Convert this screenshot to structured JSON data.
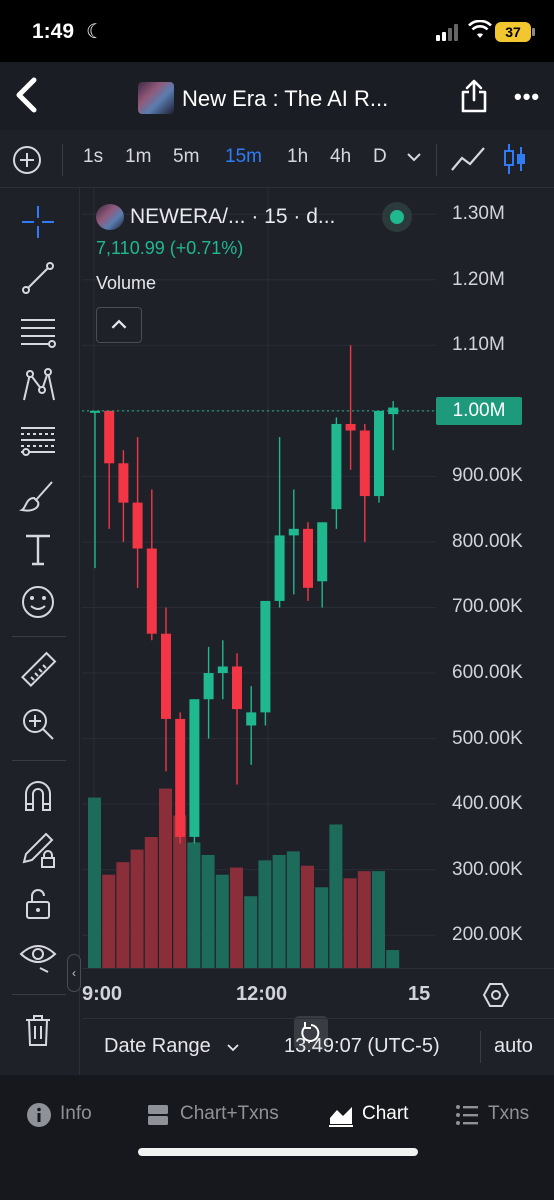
{
  "status_bar": {
    "time": "1:49",
    "battery": "37",
    "dnd_icon": "moon-icon",
    "signal_icon": "cellular-signal-icon",
    "wifi_icon": "wifi-icon"
  },
  "header": {
    "title": "New Era : The AI R...",
    "back_icon": "chevron-left-icon",
    "share_icon": "share-icon",
    "more_label": "•••"
  },
  "toolbar": {
    "timeframes": [
      "1s",
      "1m",
      "5m",
      "15m",
      "1h",
      "4h",
      "D"
    ],
    "active_timeframe": "15m"
  },
  "legend": {
    "symbol": "NEWERA/... · 15 · d...",
    "price_change": "7,110.99 (+0.71%)",
    "volume_label": "Volume"
  },
  "colors": {
    "up": "#1fb88f",
    "down": "#f23645",
    "up_volume": "#1d6b5a",
    "down_volume": "#8a2e3a",
    "accent": "#2f7cf6",
    "price_tag": "#1d9a7b"
  },
  "chart_data": {
    "type": "candlestick",
    "y_tick_labels": [
      "1.30M",
      "1.20M",
      "1.10M",
      "1.00M",
      "900.00K",
      "800.00K",
      "700.00K",
      "600.00K",
      "500.00K",
      "400.00K",
      "300.00K",
      "200.00K"
    ],
    "ylim": [
      150000,
      1340000
    ],
    "x_tick_labels": [
      "9:00",
      "12:00",
      "15"
    ],
    "last_price_label": "1.00M",
    "candles": [
      {
        "o": 1000000,
        "h": 1000000,
        "l": 760000,
        "c": 1000000
      },
      {
        "o": 1000000,
        "h": 1000000,
        "l": 820000,
        "c": 920000
      },
      {
        "o": 920000,
        "h": 940000,
        "l": 800000,
        "c": 860000
      },
      {
        "o": 860000,
        "h": 960000,
        "l": 730000,
        "c": 790000
      },
      {
        "o": 790000,
        "h": 880000,
        "l": 650000,
        "c": 660000
      },
      {
        "o": 660000,
        "h": 700000,
        "l": 450000,
        "c": 530000
      },
      {
        "o": 530000,
        "h": 540000,
        "l": 340000,
        "c": 350000
      },
      {
        "o": 350000,
        "h": 560000,
        "l": 340000,
        "c": 560000
      },
      {
        "o": 560000,
        "h": 640000,
        "l": 500000,
        "c": 600000
      },
      {
        "o": 600000,
        "h": 650000,
        "l": 560000,
        "c": 610000
      },
      {
        "o": 610000,
        "h": 630000,
        "l": 430000,
        "c": 545000
      },
      {
        "o": 520000,
        "h": 580000,
        "l": 460000,
        "c": 540000
      },
      {
        "o": 540000,
        "h": 700000,
        "l": 520000,
        "c": 710000
      },
      {
        "o": 710000,
        "h": 960000,
        "l": 700000,
        "c": 810000
      },
      {
        "o": 810000,
        "h": 880000,
        "l": 720000,
        "c": 820000
      },
      {
        "o": 820000,
        "h": 830000,
        "l": 710000,
        "c": 730000
      },
      {
        "o": 740000,
        "h": 830000,
        "l": 700000,
        "c": 830000
      },
      {
        "o": 850000,
        "h": 990000,
        "l": 820000,
        "c": 980000
      },
      {
        "o": 980000,
        "h": 1100000,
        "l": 910000,
        "c": 970000
      },
      {
        "o": 970000,
        "h": 980000,
        "l": 800000,
        "c": 870000
      },
      {
        "o": 870000,
        "h": 1000000,
        "l": 860000,
        "c": 1000000
      },
      {
        "o": 995000,
        "h": 1015000,
        "l": 940000,
        "c": 1005000
      }
    ],
    "volume_fractions": [
      0.95,
      0.52,
      0.59,
      0.66,
      0.73,
      1.0,
      0.85,
      0.7,
      0.63,
      0.52,
      0.56,
      0.4,
      0.6,
      0.63,
      0.65,
      0.57,
      0.45,
      0.8,
      0.5,
      0.54,
      0.54,
      0.1
    ],
    "grid": true
  },
  "bottom_controls": {
    "date_range_label": "Date Range",
    "clock": "13:49:07 (UTC-5)",
    "scale_label": "auto"
  },
  "left_tools": [
    "crosshair-icon",
    "trend-line-icon",
    "horizontal-lines-icon",
    "pattern-icon",
    "fib-retracement-icon",
    "brush-icon",
    "text-icon",
    "emoji-icon",
    "ruler-icon",
    "zoom-in-icon",
    "magnet-icon",
    "lock-drawing-icon",
    "unlock-icon",
    "eye-icon",
    "trash-icon"
  ],
  "tabs": [
    {
      "label": "Info",
      "icon": "info-icon"
    },
    {
      "label": "Chart+Txns",
      "icon": "chart-txns-icon"
    },
    {
      "label": "Chart",
      "icon": "area-chart-icon"
    },
    {
      "label": "Txns",
      "icon": "list-icon"
    }
  ],
  "active_tab": "Chart"
}
